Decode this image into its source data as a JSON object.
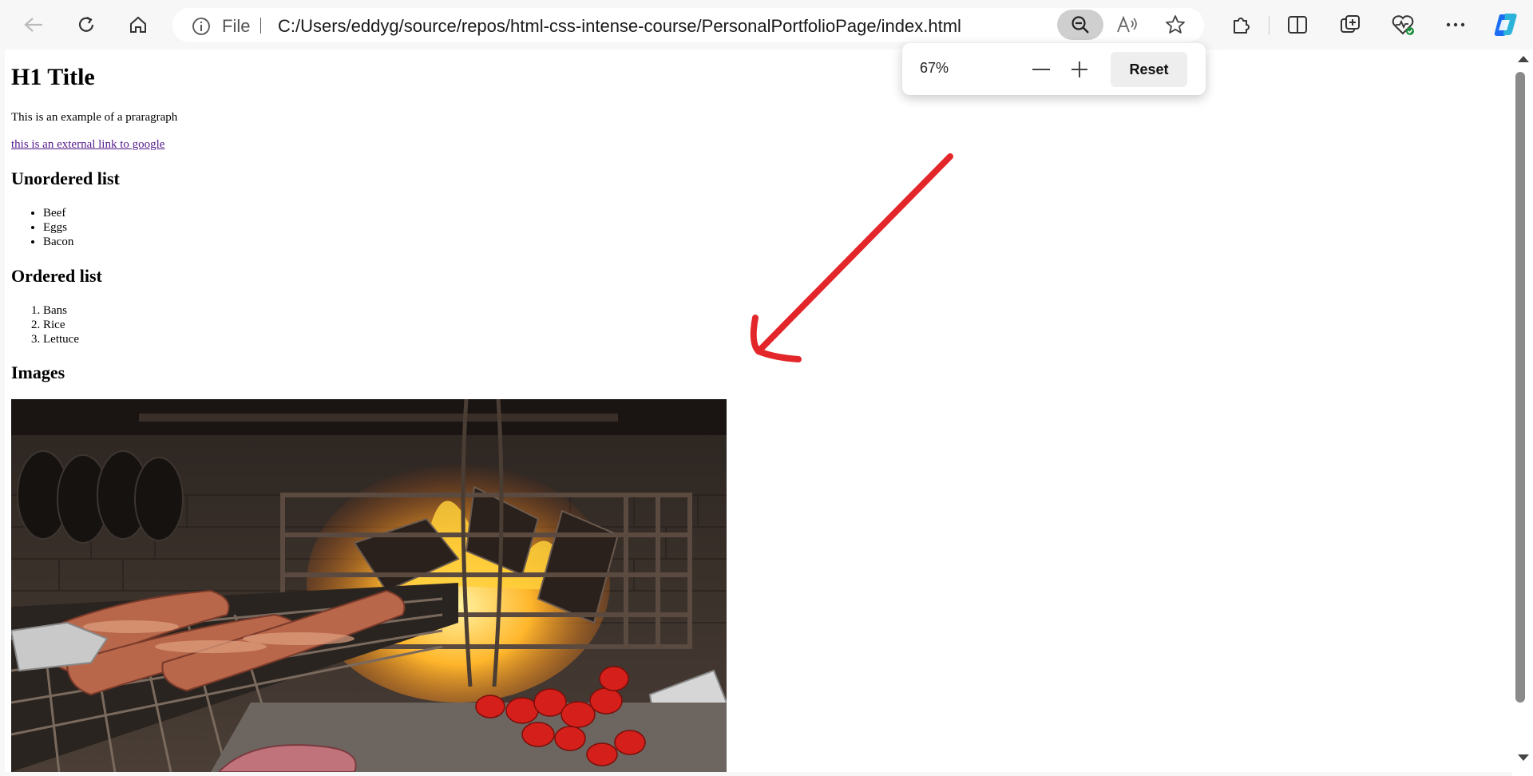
{
  "browser": {
    "address": {
      "scheme_label": "File",
      "url": "C:/Users/eddyg/source/repos/html-css-intense-course/PersonalPortfolioPage/index.html"
    },
    "zoom_popup": {
      "level": "67%",
      "reset_label": "Reset"
    }
  },
  "page": {
    "h1": "H1 Title",
    "paragraph": "This is an example of a praragraph",
    "link_text": "this is an external link to google",
    "unordered_heading": "Unordered list",
    "unordered_items": [
      "Beef",
      "Eggs",
      "Bacon"
    ],
    "ordered_heading": "Ordered list",
    "ordered_items": [
      "Bans",
      "Rice",
      "Lettuce"
    ],
    "images_heading": "Images"
  },
  "colors": {
    "annotation_arrow": "#e3262a",
    "link": "#551a8b",
    "edge_icon_blue": "#1b6ef3"
  }
}
